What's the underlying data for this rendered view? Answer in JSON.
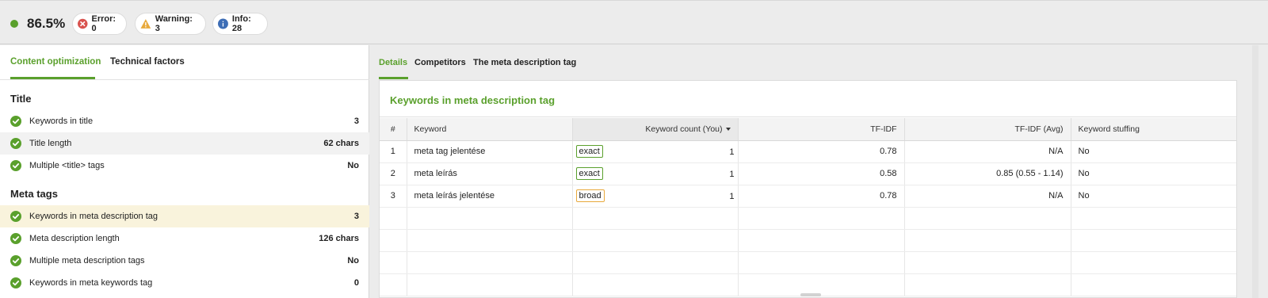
{
  "summary": {
    "score": "86.5%",
    "score_color": "#5aa02c",
    "error_label": "Error: 0",
    "warning_label": "Warning: 3",
    "info_label": "Info: 28",
    "icons": [
      "error-icon",
      "warning-icon",
      "info-icon"
    ]
  },
  "left": {
    "tabs": [
      {
        "label": "Content optimization",
        "active": true
      },
      {
        "label": "Technical factors",
        "active": false
      }
    ],
    "sections": [
      {
        "title": "Title",
        "rows": [
          {
            "label": "Keywords in title",
            "value": "3"
          },
          {
            "label": "Title length",
            "value": "62 chars"
          },
          {
            "label": "Multiple <title> tags",
            "value": "No"
          }
        ]
      },
      {
        "title": "Meta tags",
        "rows": [
          {
            "label": "Keywords in meta description tag",
            "value": "3"
          },
          {
            "label": "Meta description length",
            "value": "126 chars"
          },
          {
            "label": "Multiple meta description tags",
            "value": "No"
          },
          {
            "label": "Keywords in meta keywords tag",
            "value": "0"
          }
        ]
      }
    ]
  },
  "right": {
    "tabs": [
      {
        "label": "Details",
        "active": true
      },
      {
        "label": "Competitors",
        "active": false
      },
      {
        "label": "The meta description tag",
        "active": false
      }
    ],
    "card_title": "Keywords in meta description tag",
    "table": {
      "headers": [
        "#",
        "Keyword",
        "Keyword count (You)",
        "TF-IDF",
        "TF-IDF (Avg)",
        "Keyword stuffing"
      ],
      "rows": [
        {
          "num": "1",
          "keyword": "meta tag jelentése",
          "match": "exact",
          "count": "1",
          "tfidf": "0.78",
          "tfidf_avg": "N/A",
          "stuffing": "No"
        },
        {
          "num": "2",
          "keyword": "meta leírás",
          "match": "exact",
          "count": "1",
          "tfidf": "0.58",
          "tfidf_avg": "0.85 (0.55 - 1.14)",
          "stuffing": "No"
        },
        {
          "num": "3",
          "keyword": "meta leírás jelentése",
          "match": "broad",
          "count": "1",
          "tfidf": "0.78",
          "tfidf_avg": "N/A",
          "stuffing": "No"
        }
      ]
    }
  },
  "colors": {
    "accent_green": "#5aa02c",
    "warning_orange": "#e8a93c",
    "error_red": "#d9534f",
    "info_blue": "#3d6db5"
  }
}
